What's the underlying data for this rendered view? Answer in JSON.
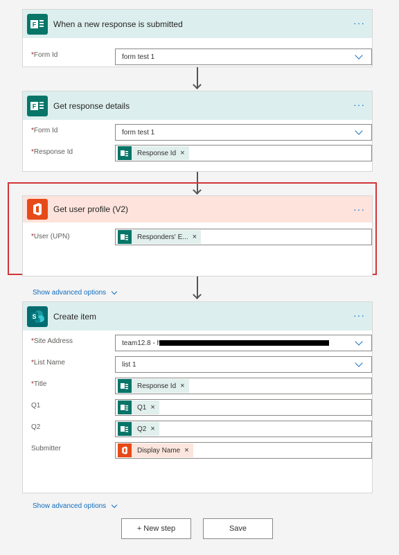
{
  "cards": {
    "trigger": {
      "title": "When a new response is submitted",
      "more": "···",
      "fields": {
        "form_id": {
          "label": "Form Id",
          "value": "form test 1"
        }
      }
    },
    "get_response": {
      "title": "Get response details",
      "more": "···",
      "fields": {
        "form_id": {
          "label": "Form Id",
          "value": "form test 1"
        },
        "response_id": {
          "label": "Response Id",
          "token": "Response Id"
        }
      }
    },
    "get_user": {
      "title": "Get user profile (V2)",
      "more": "···",
      "fields": {
        "user": {
          "label": "User (UPN)",
          "token": "Responders' E..."
        }
      },
      "advanced": "Show advanced options"
    },
    "create_item": {
      "title": "Create item",
      "more": "···",
      "fields": {
        "site": {
          "label": "Site Address",
          "value": "team12.8 - h"
        },
        "list": {
          "label": "List Name",
          "value": "list 1"
        },
        "title": {
          "label": "Title",
          "token": "Response Id"
        },
        "q1": {
          "label": "Q1",
          "token": "Q1"
        },
        "q2": {
          "label": "Q2",
          "token": "Q2"
        },
        "submitter": {
          "label": "Submitter",
          "token": "Display Name"
        }
      },
      "advanced": "Show advanced options"
    }
  },
  "required_mark": "*",
  "token_remove": "×",
  "buttons": {
    "new_step": "+ New step",
    "save": "Save"
  },
  "colors": {
    "forms_header": "#dcefee",
    "office_header": "#fde3dc",
    "highlight_border": "#d13438",
    "link": "#0f6cbd"
  },
  "icons": [
    "forms-icon",
    "office-icon",
    "sharepoint-icon",
    "chevron-down-icon",
    "more-icon",
    "arrow-down-icon"
  ]
}
